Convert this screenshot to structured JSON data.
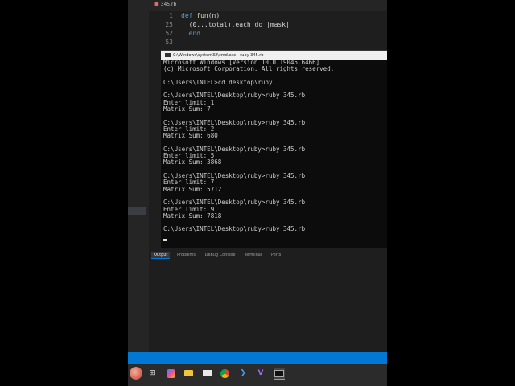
{
  "editor": {
    "tab_label": "345.rb",
    "lines": [
      {
        "num": "1",
        "code_kw": "def ",
        "code_fn": "fun",
        "code_rest": "(n)"
      },
      {
        "num": "25",
        "code_kw": "",
        "code_fn": "",
        "code_rest": "  (0...total).each do |mask|"
      },
      {
        "num": "52",
        "code_kw": "  end",
        "code_fn": "",
        "code_rest": ""
      },
      {
        "num": "53",
        "code_kw": "",
        "code_fn": "",
        "code_rest": ""
      }
    ]
  },
  "cmd": {
    "title": "C:\\Windows\\system32\\cmd.exe - ruby 345.rb",
    "lines": [
      "Microsoft Windows [Version 10.0.19045.6466]",
      "(c) Microsoft Corporation. All rights reserved.",
      "",
      "C:\\Users\\INTEL>cd desktop\\ruby",
      "",
      "C:\\Users\\INTEL\\Desktop\\ruby>ruby 345.rb",
      "Enter limit: 1",
      "Matrix Sum: 7",
      "",
      "C:\\Users\\INTEL\\Desktop\\ruby>ruby 345.rb",
      "Enter limit: 2",
      "Matrix Sum: 680",
      "",
      "C:\\Users\\INTEL\\Desktop\\ruby>ruby 345.rb",
      "Enter limit: 5",
      "Matrix Sum: 3868",
      "",
      "C:\\Users\\INTEL\\Desktop\\ruby>ruby 345.rb",
      "Enter limit: 7",
      "Matrix Sum: 5712",
      "",
      "C:\\Users\\INTEL\\Desktop\\ruby>ruby 345.rb",
      "Enter limit: 9",
      "Matrix Sum: 7818",
      "",
      "C:\\Users\\INTEL\\Desktop\\ruby>ruby 345.rb"
    ]
  },
  "panel": {
    "tabs": [
      "Output",
      "Problems",
      "Debug Console",
      "Terminal",
      "Ports"
    ]
  },
  "taskbar": {
    "icons": [
      "weather-icon",
      "task-view-icon",
      "copilot-icon",
      "file-explorer-icon",
      "mail-icon",
      "chrome-icon",
      "vscode-icon",
      "visual-studio-icon",
      "terminal-icon"
    ]
  },
  "colors": {
    "accent": "#0078d4",
    "editor_bg": "#1e1e1e",
    "console_bg": "#0c0c0c"
  }
}
